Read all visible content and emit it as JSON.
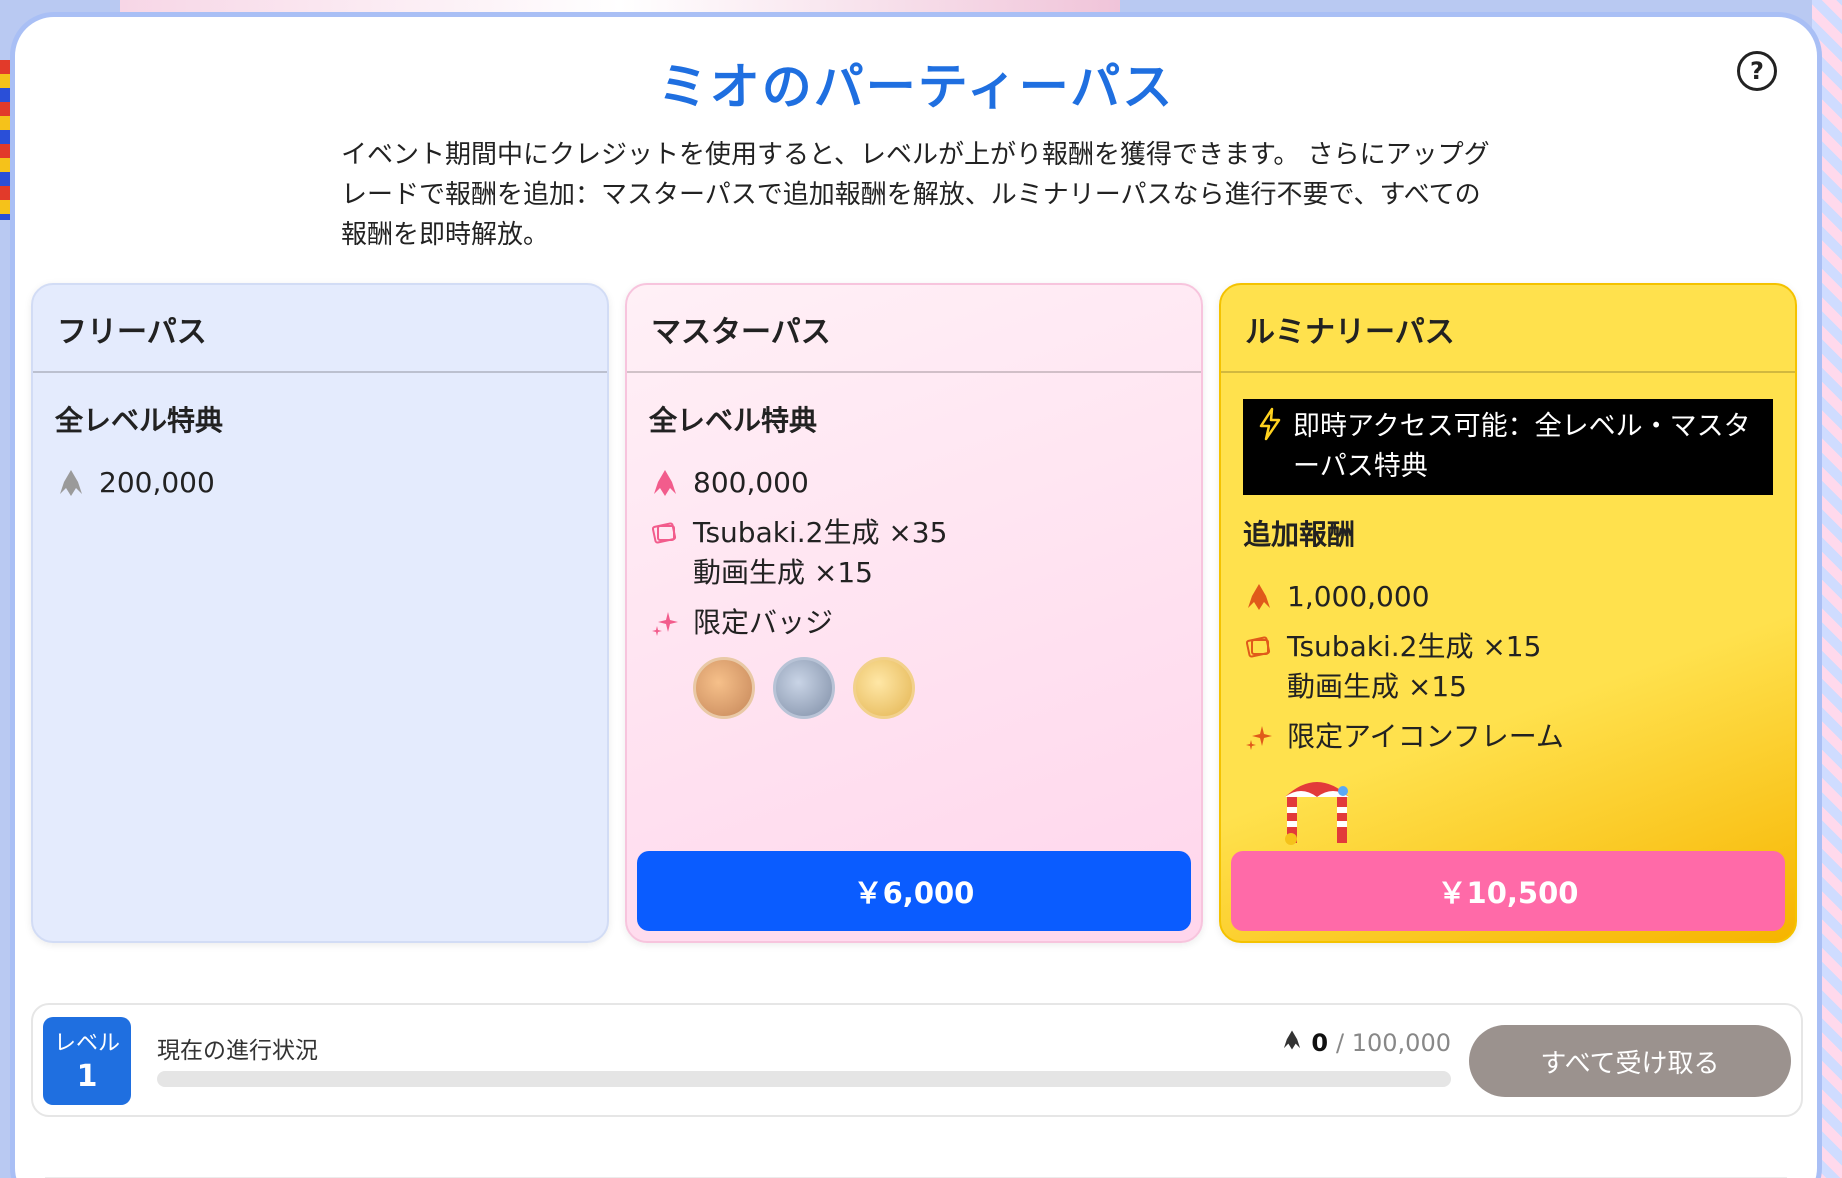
{
  "modal": {
    "title": "ミオのパーティーパス",
    "help_icon": "question-circle-icon",
    "description": "イベント期間中にクレジットを使用すると、レベルが上がり報酬を獲得できます。 さらにアップグレードで報酬を追加：マスターパスで追加報酬を解放、ルミナリーパスなら進行不要で、すべての報酬を即時解放。"
  },
  "passes": {
    "free": {
      "name": "フリーパス",
      "section": "全レベル特典",
      "credits": "200,000"
    },
    "master": {
      "name": "マスターパス",
      "section": "全レベル特典",
      "credits": "800,000",
      "gen_line1": "Tsubaki.2生成 ×35",
      "gen_line2": "動画生成 ×15",
      "badge_label": "限定バッジ",
      "price": "￥6,000"
    },
    "luminary": {
      "name": "ルミナリーパス",
      "instant": "即時アクセス可能：全レベル・マスターパス特典",
      "section": "追加報酬",
      "credits": "1,000,000",
      "gen_line1": "Tsubaki.2生成 ×15",
      "gen_line2": "動画生成 ×15",
      "frame_label": "限定アイコンフレーム",
      "price": "￥10,500"
    }
  },
  "progress": {
    "level_label": "レベル",
    "level": "1",
    "label": "現在の進行状況",
    "current": "0",
    "max": "/ 100,000",
    "fraction": 0,
    "claim_button": "すべて受け取る"
  },
  "colors": {
    "accent": "#1f6fe0",
    "master_button": "#0a5cff",
    "luminary_button": "#ff6aa8",
    "claim_disabled": "#9b928e"
  }
}
